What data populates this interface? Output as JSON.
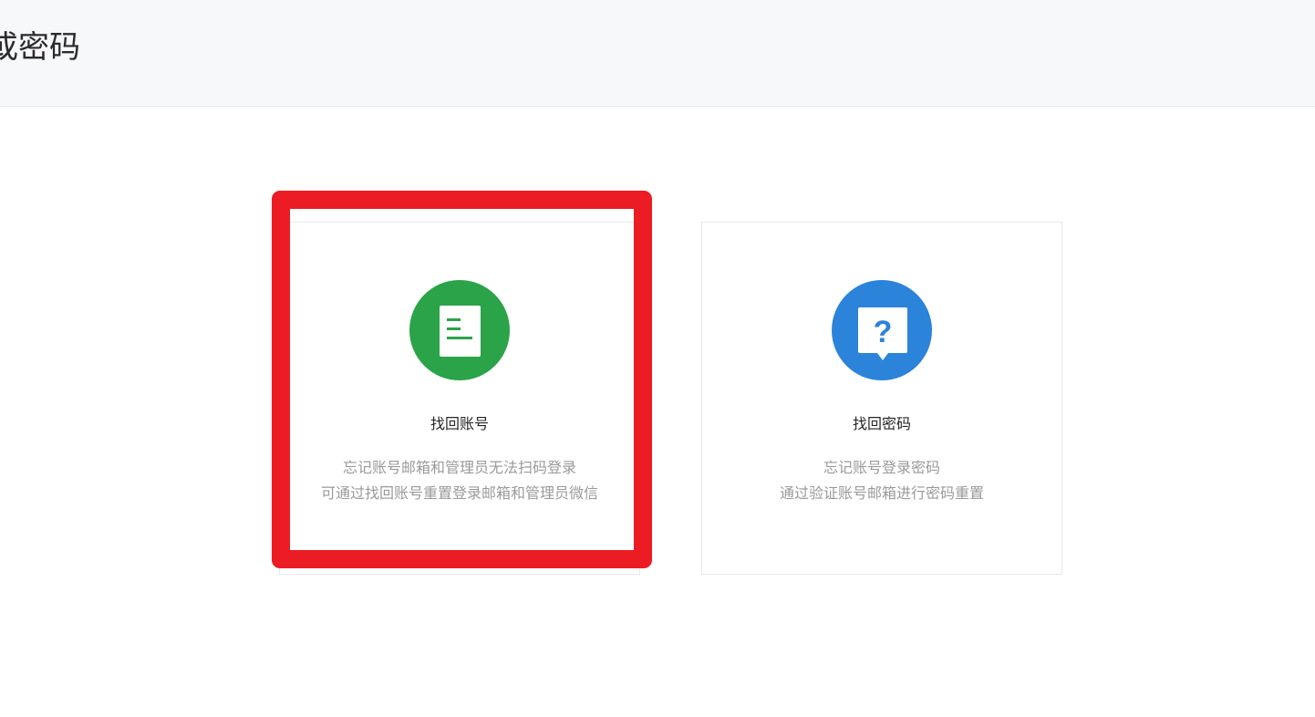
{
  "header": {
    "title": "或密码"
  },
  "cards": [
    {
      "title": "找回账号",
      "icon": "document-icon",
      "icon_color": "#2ba348",
      "desc_line1": "忘记账号邮箱和管理员无法扫码登录",
      "desc_line2": "可通过找回账号重置登录邮箱和管理员微信"
    },
    {
      "title": "找回密码",
      "icon": "question-bubble-icon",
      "icon_color": "#2b83da",
      "desc_line1": "忘记账号登录密码",
      "desc_line2": "通过验证账号邮箱进行密码重置"
    }
  ],
  "highlight": {
    "color": "#ec1c24"
  }
}
